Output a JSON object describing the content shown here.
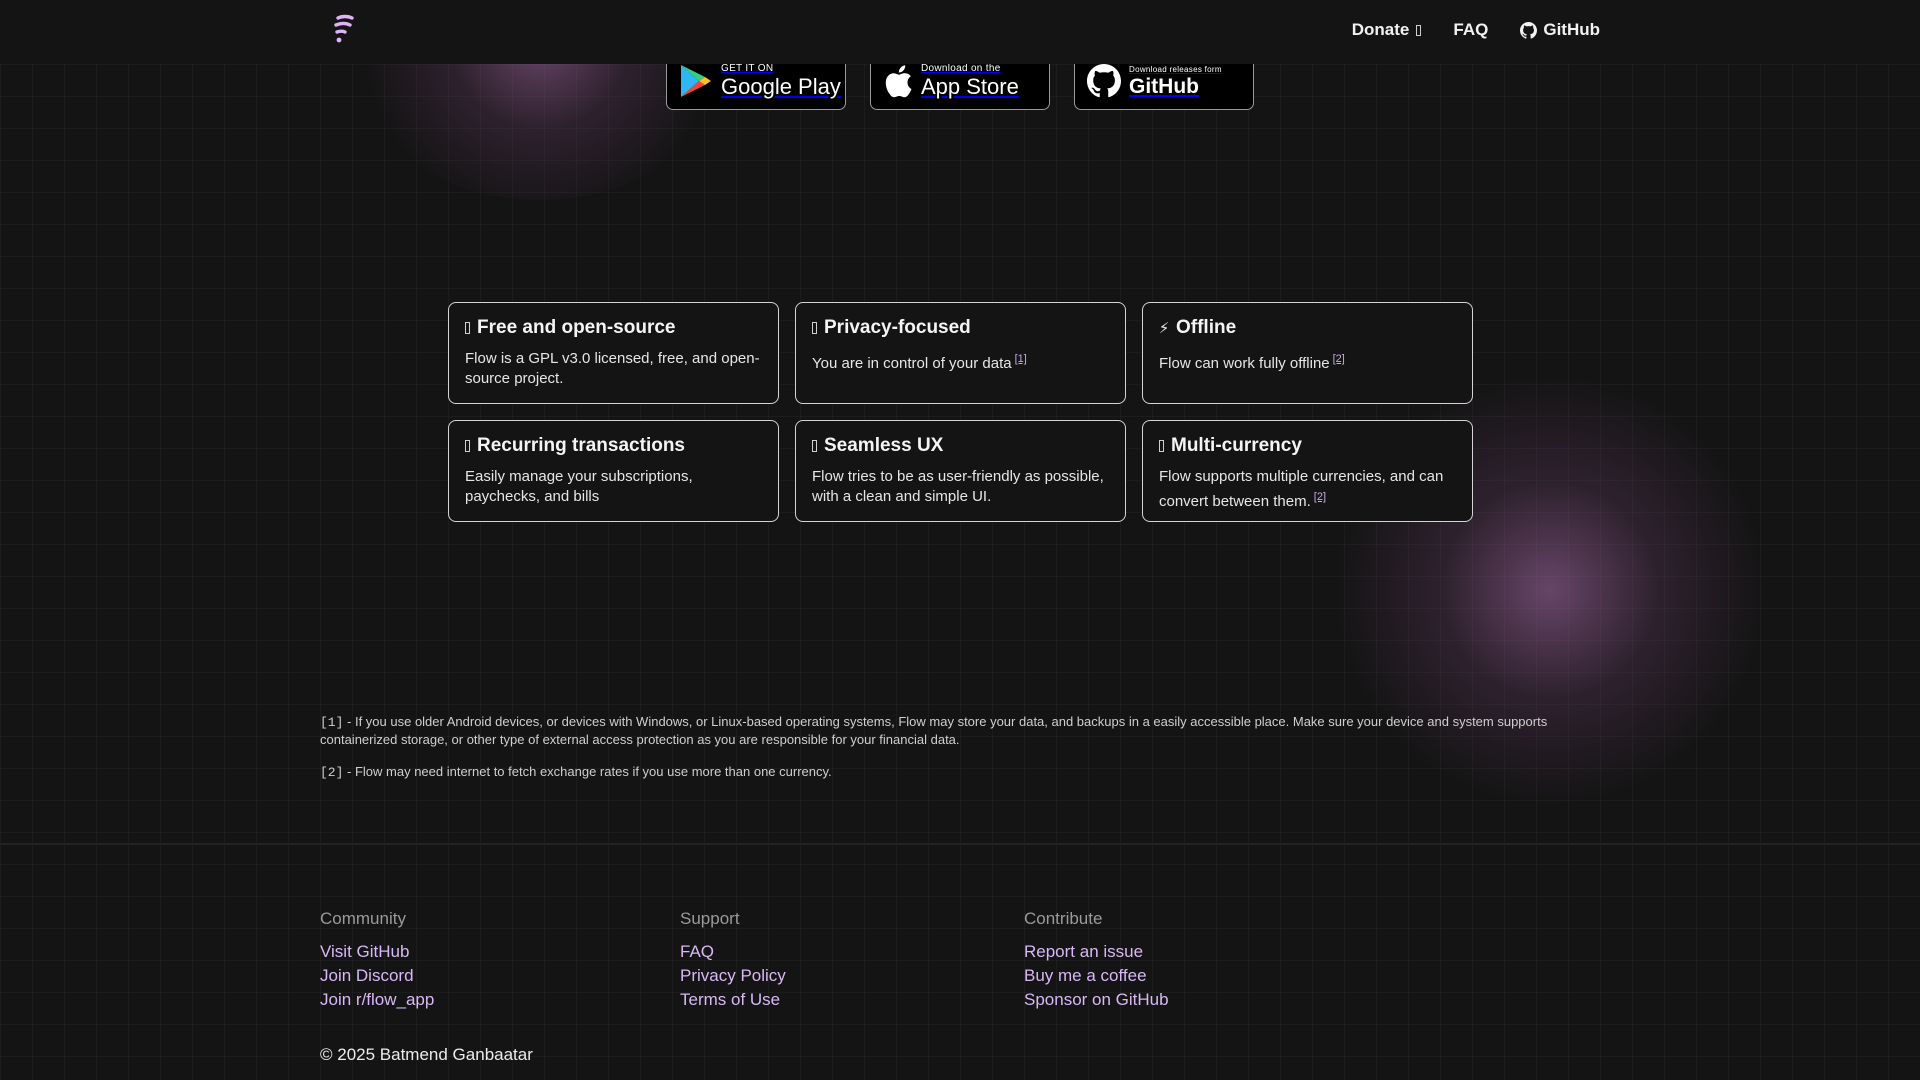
{
  "header": {
    "nav": {
      "donate": "Donate",
      "faq": "FAQ",
      "github": "GitHub"
    }
  },
  "badges": {
    "google_play": {
      "small": "GET IT ON",
      "big": "Google Play"
    },
    "app_store": {
      "small": "Download on the",
      "big": "App Store"
    },
    "github": {
      "small": "Download releases form",
      "big": "GitHub"
    }
  },
  "features": [
    {
      "icon": "box-glyph",
      "title": "Free and open-source",
      "desc": "Flow is a GPL v3.0 licensed, free, and open-source project.",
      "ref": ""
    },
    {
      "icon": "box-glyph",
      "title": "Privacy-focused",
      "desc": "You are in control of your data",
      "ref": "[1]"
    },
    {
      "icon": "lightning-icon",
      "title": "Offline",
      "desc": "Flow can work fully offline",
      "ref": "[2]"
    },
    {
      "icon": "box-glyph",
      "title": "Recurring transactions",
      "desc": "Easily manage your subscriptions, paychecks, and bills",
      "ref": ""
    },
    {
      "icon": "box-glyph",
      "title": "Seamless UX",
      "desc": "Flow tries to be as user-friendly as possible, with a clean and simple UI.",
      "ref": ""
    },
    {
      "icon": "box-glyph",
      "title": "Multi-currency",
      "desc": "Flow supports multiple currencies, and can convert between them.",
      "ref": "[2]"
    }
  ],
  "footnotes": [
    {
      "key": "[1]",
      "text": " - If you use older Android devices, or devices with Windows, or Linux-based operating systems, Flow may store your data, and backups in a easily accessible place. Make sure your device and system supports containerized storage, or other type of external access protection as you are responsible for your financial data."
    },
    {
      "key": "[2]",
      "text": " - Flow may need internet to fetch exchange rates if you use more than one currency."
    }
  ],
  "footer": {
    "community": {
      "heading": "Community",
      "links": [
        "Visit GitHub",
        "Join Discord",
        "Join r/flow_app"
      ]
    },
    "support": {
      "heading": "Support",
      "links": [
        "FAQ",
        "Privacy Policy",
        "Terms of Use"
      ]
    },
    "contribute": {
      "heading": "Contribute",
      "links": [
        "Report an issue",
        "Buy me a coffee",
        "Sponsor on GitHub"
      ]
    },
    "copyright": "© 2025 Batmend Ganbaatar"
  },
  "colors": {
    "accent": "#d8b8f5",
    "logo": "#e0b3f7",
    "background": "#141414"
  }
}
